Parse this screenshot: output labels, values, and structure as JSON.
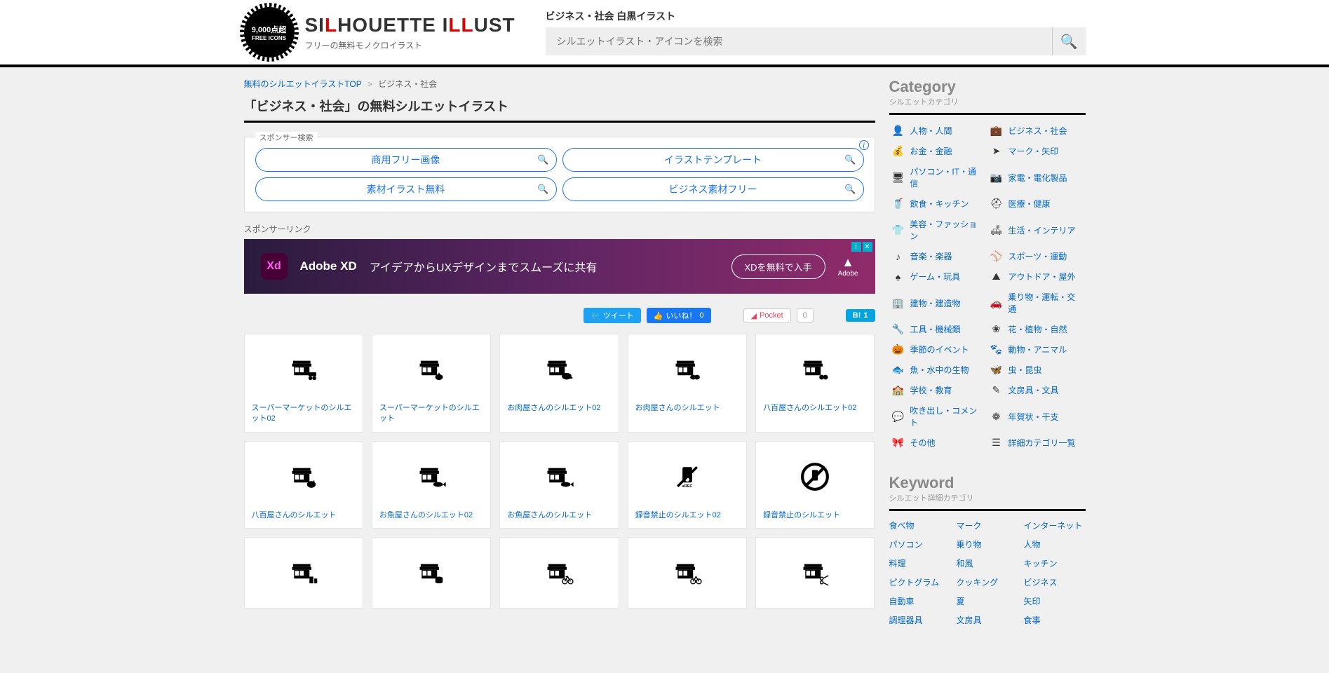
{
  "header": {
    "badge_top": "9,000点超",
    "badge_bottom": "FREE ICONS",
    "logo_before": "SI",
    "logo_l1": "L",
    "logo_mid": "HOUETTE I",
    "logo_l2": "LL",
    "logo_after": "UST",
    "tagline": "フリーの無料モノクロイラスト",
    "search_title": "ビジネス・社会 白黒イラスト",
    "search_placeholder": "シルエットイラスト・アイコンを検索"
  },
  "breadcrumb": {
    "home": "無料のシルエットイラストTOP",
    "sep": ">",
    "current": "ビジネス・社会"
  },
  "page_title": "「ビジネス・社会」の無料シルエットイラスト",
  "sponsor": {
    "label": "スポンサー検索",
    "links": [
      "商用フリー画像",
      "イラストテンプレート",
      "素材イラスト無料",
      "ビジネス素材フリー"
    ]
  },
  "sponsor_link_label": "スポンサーリンク",
  "banner": {
    "xd": "Xd",
    "brand": "Adobe XD",
    "text": "アイデアからUXデザインまでスムーズに共有",
    "cta": "XDを無料で入手",
    "adobe": "Adobe"
  },
  "share": {
    "tweet": "ツイート",
    "like": "いいね！",
    "like_count": "0",
    "pocket": "Pocket",
    "pocket_count": "0",
    "hatena": "B!",
    "hatena_count": "1"
  },
  "items": [
    {
      "title": "スーパーマーケットのシルエット02",
      "icon": "store-cart"
    },
    {
      "title": "スーパーマーケットのシルエット",
      "icon": "store-veg"
    },
    {
      "title": "お肉屋さんのシルエット02",
      "icon": "store-meat"
    },
    {
      "title": "お肉屋さんのシルエット",
      "icon": "store-bread"
    },
    {
      "title": "八百屋さんのシルエット02",
      "icon": "store-fruit"
    },
    {
      "title": "八百屋さんのシルエット",
      "icon": "store-veg2"
    },
    {
      "title": "お魚屋さんのシルエット02",
      "icon": "store-fish"
    },
    {
      "title": "お魚屋さんのシルエット",
      "icon": "store-fish2"
    },
    {
      "title": "録音禁止のシルエット02",
      "icon": "no-rec"
    },
    {
      "title": "録音禁止のシルエット",
      "icon": "no-rec-circle"
    },
    {
      "title": "",
      "icon": "store-drink"
    },
    {
      "title": "",
      "icon": "store-burger"
    },
    {
      "title": "",
      "icon": "store-bike"
    },
    {
      "title": "",
      "icon": "store-bike2"
    },
    {
      "title": "",
      "icon": "store-cut"
    }
  ],
  "sidebar": {
    "cat_title": "Category",
    "cat_sub": "シルエットカテゴリ",
    "categories": [
      {
        "icon": "👤",
        "label": "人物・人間"
      },
      {
        "icon": "💼",
        "label": "ビジネス・社会"
      },
      {
        "icon": "💰",
        "label": "お金・金融"
      },
      {
        "icon": "➤",
        "label": "マーク・矢印"
      },
      {
        "icon": "🖥",
        "label": "パソコン・IT・通信"
      },
      {
        "icon": "📷",
        "label": "家電・電化製品"
      },
      {
        "icon": "🥤",
        "label": "飲食・キッチン"
      },
      {
        "icon": "⛑",
        "label": "医療・健康"
      },
      {
        "icon": "👕",
        "label": "美容・ファッション"
      },
      {
        "icon": "🛋",
        "label": "生活・インテリア"
      },
      {
        "icon": "♪",
        "label": "音楽・楽器"
      },
      {
        "icon": "⚾",
        "label": "スポーツ・運動"
      },
      {
        "icon": "♠",
        "label": "ゲーム・玩具"
      },
      {
        "icon": "⛰",
        "label": "アウトドア・屋外"
      },
      {
        "icon": "🏢",
        "label": "建物・建造物"
      },
      {
        "icon": "🚗",
        "label": "乗り物・運転・交通"
      },
      {
        "icon": "🔧",
        "label": "工具・機械類"
      },
      {
        "icon": "❀",
        "label": "花・植物・自然"
      },
      {
        "icon": "🎃",
        "label": "季節のイベント"
      },
      {
        "icon": "🐾",
        "label": "動物・アニマル"
      },
      {
        "icon": "🐟",
        "label": "魚・水中の生物"
      },
      {
        "icon": "🦋",
        "label": "虫・昆虫"
      },
      {
        "icon": "🏫",
        "label": "学校・教育"
      },
      {
        "icon": "✎",
        "label": "文房具・文具"
      },
      {
        "icon": "💬",
        "label": "吹き出し・コメント"
      },
      {
        "icon": "❁",
        "label": "年賀状・干支"
      },
      {
        "icon": "🎀",
        "label": "その他"
      },
      {
        "icon": "☰",
        "label": "詳細カテゴリ一覧"
      }
    ],
    "kw_title": "Keyword",
    "kw_sub": "シルエット詳細カテゴリ",
    "keywords": [
      "食べ物",
      "マーク",
      "インターネット",
      "パソコン",
      "乗り物",
      "人物",
      "料理",
      "和風",
      "キッチン",
      "ピクトグラム",
      "クッキング",
      "ビジネス",
      "自動車",
      "夏",
      "矢印",
      "調理器具",
      "文房具",
      "食事"
    ]
  }
}
